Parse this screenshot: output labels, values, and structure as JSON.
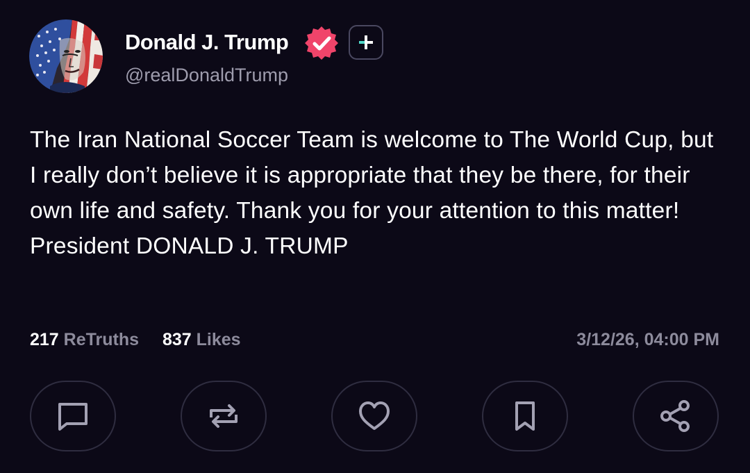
{
  "post": {
    "author": {
      "display_name": "Donald J. Trump",
      "handle": "@realDonaldTrump",
      "verified_icon": "verified-badge-icon",
      "verified_color": "#f0446a",
      "avatar": "avatar-flag-portrait"
    },
    "follow_button_icon": "plus-icon",
    "text": "The Iran National Soccer Team is welcome to The World Cup, but I really don’t believe it is appropriate that they be there, for their own life and safety. Thank you for your attention to this matter! President DONALD J. TRUMP",
    "stats": {
      "retruths_count": "217",
      "retruths_label": "ReTruths",
      "likes_count": "837",
      "likes_label": "Likes"
    },
    "timestamp": "3/12/26, 04:00 PM"
  },
  "actions": [
    {
      "name": "reply",
      "icon": "comment-icon"
    },
    {
      "name": "retruth",
      "icon": "repost-icon"
    },
    {
      "name": "like",
      "icon": "heart-icon"
    },
    {
      "name": "bookmark",
      "icon": "bookmark-icon"
    },
    {
      "name": "share",
      "icon": "share-icon"
    }
  ],
  "colors": {
    "background": "#0c0917",
    "text_primary": "#ffffff",
    "text_secondary": "#8d8b9c",
    "button_border": "#2f2d40",
    "icon_color": "#a3a1b3",
    "accent_teal": "#4fd8c8"
  }
}
